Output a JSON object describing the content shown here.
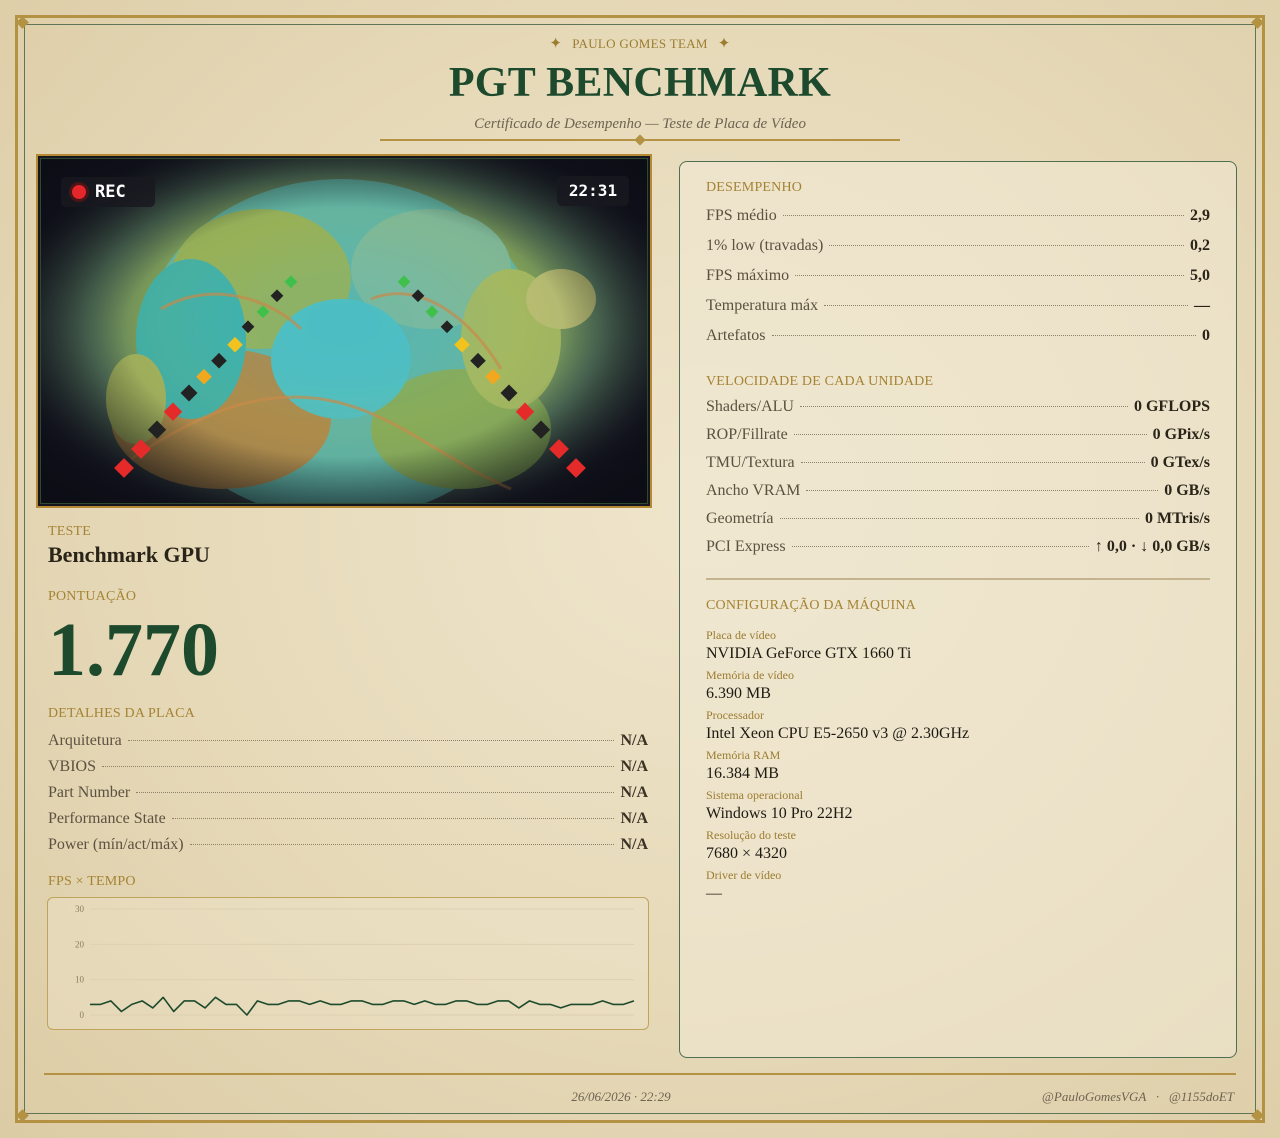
{
  "header": {
    "team": "PAULO GOMES TEAM",
    "title": "PGT BENCHMARK",
    "subtitle": "Certificado de Desempenho — Teste de Placa de Vídeo"
  },
  "video": {
    "rec_label": "REC",
    "clock": "22:31"
  },
  "test": {
    "label": "TESTE",
    "value": "Benchmark GPU"
  },
  "score": {
    "label": "PONTUAÇÃO",
    "value": "1.770"
  },
  "board_details": {
    "label": "DETALHES DA PLACA",
    "rows": [
      {
        "label": "Arquitetura",
        "value": "N/A"
      },
      {
        "label": "VBIOS",
        "value": "N/A"
      },
      {
        "label": "Part Number",
        "value": "N/A"
      },
      {
        "label": "Performance State",
        "value": "N/A"
      },
      {
        "label": "Power (mín/act/máx)",
        "value": "N/A"
      }
    ]
  },
  "chart_data": {
    "type": "line",
    "title": "FPS × TEMPO",
    "xlabel": "",
    "ylabel": "",
    "ylim": [
      0,
      30
    ],
    "yticks": [
      "0",
      "10",
      "20",
      "30"
    ],
    "grid": true,
    "series": [
      {
        "values": [
          3,
          3,
          4,
          1,
          3,
          4,
          2,
          5,
          1,
          4,
          4,
          2,
          5,
          3,
          3,
          0,
          4,
          3,
          3,
          4,
          4,
          3,
          4,
          3,
          3,
          4,
          4,
          3,
          3,
          4,
          4,
          3,
          4,
          3,
          3,
          4,
          4,
          3,
          3,
          4,
          4,
          2,
          4,
          3,
          3,
          2,
          3,
          3,
          3,
          4,
          3,
          3,
          4
        ]
      }
    ]
  },
  "performance": {
    "label": "DESEMPENHO",
    "rows": [
      {
        "label": "FPS médio",
        "value": "2,9"
      },
      {
        "label": "1% low (travadas)",
        "value": "0,2"
      },
      {
        "label": "FPS máximo",
        "value": "5,0"
      },
      {
        "label": "Temperatura máx",
        "value": "—"
      },
      {
        "label": "Artefatos",
        "value": "0"
      }
    ]
  },
  "unit_speed": {
    "label": "VELOCIDADE DE CADA UNIDADE",
    "rows": [
      {
        "label": "Shaders/ALU",
        "value": "0 GFLOPS"
      },
      {
        "label": "ROP/Fillrate",
        "value": "0 GPix/s"
      },
      {
        "label": "TMU/Textura",
        "value": "0 GTex/s"
      },
      {
        "label": "Ancho VRAM",
        "value": "0 GB/s"
      },
      {
        "label": "Geometría",
        "value": "0 MTris/s"
      },
      {
        "label": "PCI Express",
        "value": "↑ 0,0 · ↓ 0,0 GB/s"
      }
    ]
  },
  "machine": {
    "label": "CONFIGURAÇÃO DA MÁQUINA",
    "items": [
      {
        "key": "Placa de vídeo",
        "value": "NVIDIA GeForce GTX 1660 Ti"
      },
      {
        "key": "Memória de vídeo",
        "value": "6.390 MB"
      },
      {
        "key": "Processador",
        "value": "Intel Xeon CPU E5-2650 v3 @ 2.30GHz"
      },
      {
        "key": "Memória RAM",
        "value": "16.384 MB"
      },
      {
        "key": "Sistema operacional",
        "value": "Windows 10 Pro 22H2"
      },
      {
        "key": "Resolução do teste",
        "value": "7680 × 4320"
      },
      {
        "key": "Driver de vídeo",
        "value": "—"
      }
    ]
  },
  "footer": {
    "date": "26/06/2026 · 22:29",
    "handles": "@PauloGomesVGA   ·   @1155doET"
  },
  "colors": {
    "gold": "#b39244",
    "green": "#1d4a2c",
    "panel_border": "#4f6e52",
    "background": "#e9dec2"
  }
}
